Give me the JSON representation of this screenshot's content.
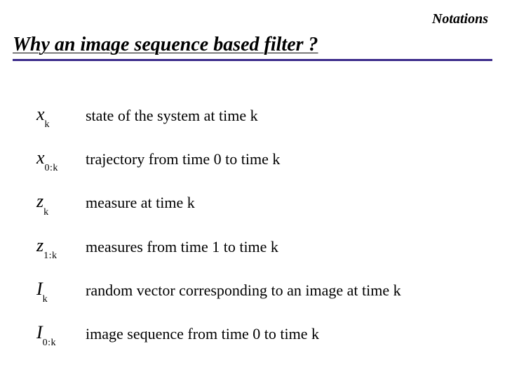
{
  "header": {
    "corner": "Notations",
    "title": "Why an image sequence based filter ?"
  },
  "rows": [
    {
      "base": "x",
      "sub": "k",
      "desc": "state of the system at time k"
    },
    {
      "base": "x",
      "sub": "0:k",
      "desc": "trajectory from time 0 to time k"
    },
    {
      "base": "z",
      "sub": "k",
      "desc": "measure at time k"
    },
    {
      "base": "z",
      "sub": "1:k",
      "desc": "measures from time 1 to time k"
    },
    {
      "base": "I",
      "sub": "k",
      "desc": "random vector corresponding to an image at time k"
    },
    {
      "base": "I",
      "sub": "0:k",
      "desc": "image sequence from time 0 to time k"
    }
  ]
}
